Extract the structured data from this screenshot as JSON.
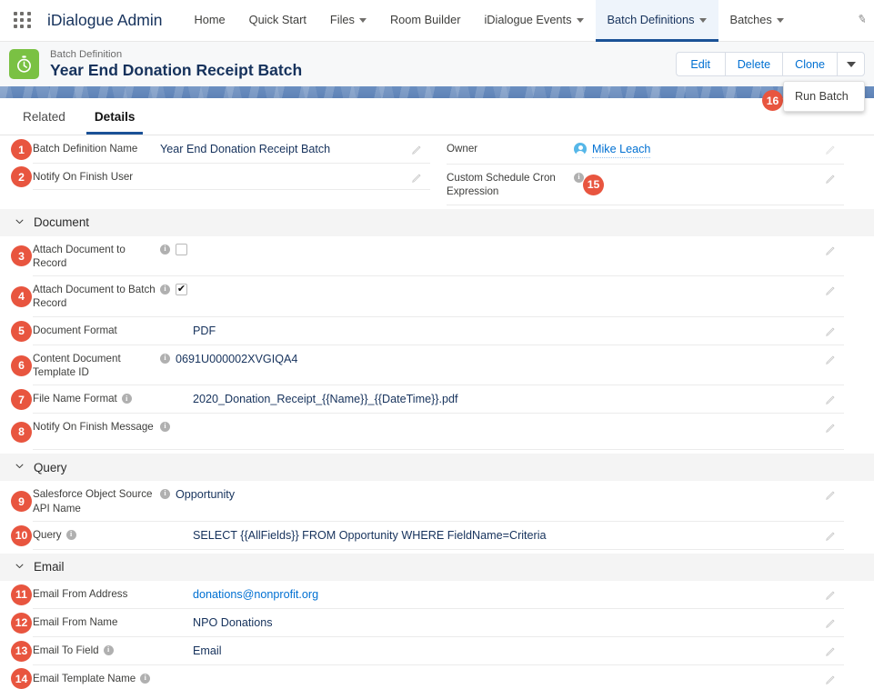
{
  "global_nav": {
    "app_launcher_icon": "app-launcher-grid-icon",
    "app_name": "iDialogue Admin",
    "items": [
      {
        "label": "Home",
        "has_caret": false,
        "active": false
      },
      {
        "label": "Quick Start",
        "has_caret": false,
        "active": false
      },
      {
        "label": "Files",
        "has_caret": true,
        "active": false
      },
      {
        "label": "Room Builder",
        "has_caret": false,
        "active": false
      },
      {
        "label": "iDialogue Events",
        "has_caret": true,
        "active": false
      },
      {
        "label": "Batch Definitions",
        "has_caret": true,
        "active": true
      },
      {
        "label": "Batches",
        "has_caret": true,
        "active": false
      }
    ],
    "edge_icon": "pencil-icon"
  },
  "record_header": {
    "icon": "stopwatch-icon",
    "icon_color": "#7ac143",
    "record_type": "Batch Definition",
    "record_name": "Year End Donation Receipt Batch",
    "actions": [
      {
        "label": "Edit",
        "name": "edit-button"
      },
      {
        "label": "Delete",
        "name": "delete-button"
      },
      {
        "label": "Clone",
        "name": "clone-button"
      }
    ],
    "more_caret_icon": "chevron-down-icon",
    "dropdown": {
      "open": true,
      "items": [
        {
          "label": "Run Batch"
        }
      ]
    }
  },
  "tabs": [
    {
      "label": "Related",
      "active": false
    },
    {
      "label": "Details",
      "active": true
    }
  ],
  "top_fields": {
    "left": [
      {
        "badge": "1",
        "label": "Batch Definition Name",
        "value": "Year End Donation Receipt Batch",
        "info": false,
        "editable": true
      },
      {
        "badge": "2",
        "label": "Notify On Finish User",
        "value": "",
        "info": false,
        "editable": true
      }
    ],
    "right": [
      {
        "badge": "",
        "label": "Owner",
        "value": "Mike Leach",
        "is_link": true,
        "avatar": true,
        "info": false,
        "editable": false
      },
      {
        "badge": "15",
        "label": "Custom Schedule Cron Expression",
        "value": "",
        "info": true,
        "editable": true
      }
    ]
  },
  "sections": [
    {
      "title": "Document",
      "collapse_icon": "chevron-down-icon",
      "fields": [
        {
          "badge": "3",
          "label": "Attach Document to Record",
          "info": true,
          "checkbox": true,
          "checked": false,
          "value": "",
          "editable": true
        },
        {
          "badge": "4",
          "label": "Attach Document to Batch Record",
          "info": true,
          "checkbox": true,
          "checked": true,
          "value": "",
          "editable": true
        },
        {
          "badge": "5",
          "label": "Document Format",
          "info": false,
          "value": "PDF",
          "indent": true,
          "editable": true
        },
        {
          "badge": "6",
          "label": "Content Document Template ID",
          "info": true,
          "value": "0691U000002XVGIQA4",
          "editable": true
        },
        {
          "badge": "7",
          "label": "File Name Format",
          "info": true,
          "inline_info": true,
          "value": "2020_Donation_Receipt_{{Name}}_{{DateTime}}.pdf",
          "indent": true,
          "editable": true
        },
        {
          "badge": "8",
          "label": "Notify On Finish Message",
          "info": true,
          "value": "",
          "editable": true
        }
      ]
    },
    {
      "title": "Query",
      "collapse_icon": "chevron-down-icon",
      "fields": [
        {
          "badge": "9",
          "label": "Salesforce Object Source API Name",
          "info": true,
          "value": "Opportunity",
          "editable": true
        },
        {
          "badge": "10",
          "label": "Query",
          "info": true,
          "inline_info": true,
          "value": "SELECT {{AllFields}} FROM Opportunity WHERE FieldName=Criteria",
          "indent": true,
          "editable": true
        }
      ]
    },
    {
      "title": "Email",
      "collapse_icon": "chevron-down-icon",
      "fields": [
        {
          "badge": "11",
          "label": "Email From Address",
          "info": false,
          "value": "donations@nonprofit.org",
          "is_link": true,
          "indent": true,
          "editable": true
        },
        {
          "badge": "12",
          "label": "Email From Name",
          "info": false,
          "value": "NPO Donations",
          "indent": true,
          "editable": true
        },
        {
          "badge": "13",
          "label": "Email To Field",
          "info": true,
          "inline_info": true,
          "value": "Email",
          "indent": true,
          "editable": true
        },
        {
          "badge": "14",
          "label": "Email Template Name",
          "info": true,
          "inline_info": true,
          "value": "",
          "editable": true
        }
      ]
    }
  ],
  "badge_color": "#e8553f",
  "accent_color": "#0070d2"
}
